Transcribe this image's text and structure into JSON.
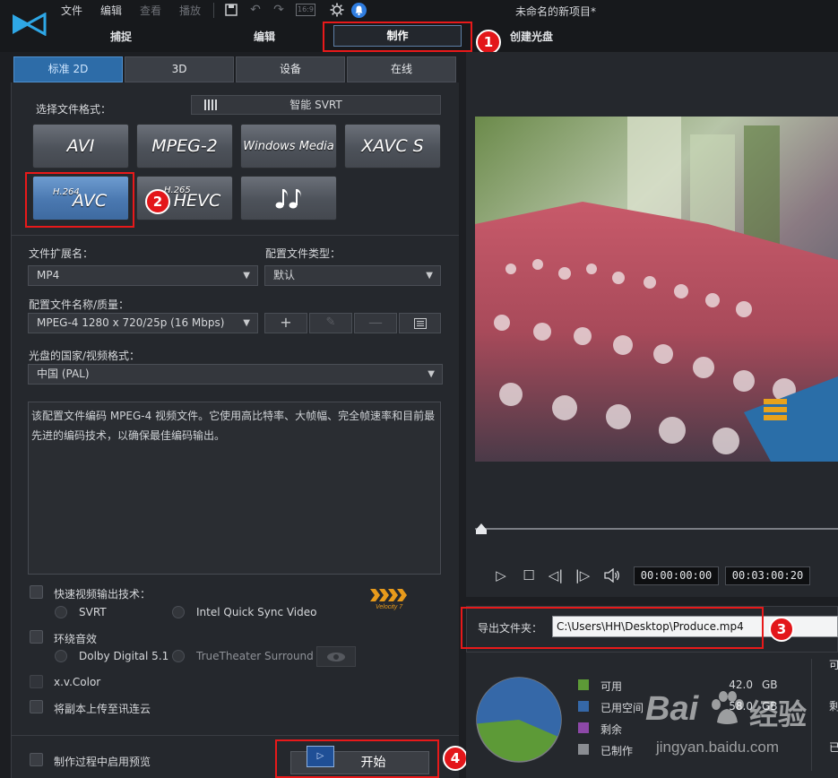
{
  "app": {
    "title": "未命名的新项目*",
    "menu": [
      "文件",
      "编辑",
      "查看",
      "播放"
    ],
    "ratio_label": "16:9"
  },
  "modes": {
    "capture": "捕捉",
    "edit": "编辑",
    "produce": "制作",
    "disc": "创建光盘"
  },
  "badges": [
    "1",
    "2",
    "3",
    "4"
  ],
  "categories": [
    "标准 2D",
    "3D",
    "设备",
    "在线"
  ],
  "format": {
    "select_label": "选择文件格式：",
    "svrt_label": "智能 SVRT",
    "buttons": [
      "AVI",
      "MPEG-2",
      "Windows Media",
      "XAVC S",
      "AVC",
      "HEVC"
    ],
    "avc_sup": "H.264",
    "hevc_sup": "H.265",
    "audio_icon": "music-notes-icon"
  },
  "settings": {
    "ext_label": "文件扩展名：",
    "ext_value": "MP4",
    "profile_type_label": "配置文件类型：",
    "profile_type_value": "默认",
    "profile_label": "配置文件名称/质量：",
    "profile_value": "MPEG-4 1280 x 720/25p (16 Mbps)",
    "country_label": "光盘的国家/视频格式：",
    "country_value": "中国 (PAL)",
    "description": "该配置文件编码 MPEG-4 视频文件。它使用高比特率、大帧幅、完全帧速率和目前最先进的编码技术，以确保最佳编码输出。"
  },
  "options": {
    "fast_render": "快速视频输出技术：",
    "svrt": "SVRT",
    "intel": "Intel Quick Sync Video",
    "surround": "环绕音效",
    "dolby": "Dolby Digital 5.1",
    "truetheater": "TrueTheater Surround",
    "xvcolor": "x.v.Color",
    "upload": "将副本上传至讯连云",
    "preview": "制作过程中启用预览",
    "velocity": "Velocity 7"
  },
  "start_label": "开始",
  "player": {
    "time_current": "00:00:00:00",
    "time_total": "00:03:00:20"
  },
  "export": {
    "label": "导出文件夹：",
    "path": "C:\\Users\\HH\\Desktop\\Produce.mp4"
  },
  "disk": {
    "items": [
      {
        "label": "可用",
        "value": "42.0",
        "unit": "GB",
        "color": "#5d9a37"
      },
      {
        "label": "已用空间",
        "value": "58.0",
        "unit": "GB",
        "color": "#3568a8"
      },
      {
        "label": "剩余",
        "value": "",
        "unit": "",
        "color": "#8d48a8"
      },
      {
        "label": "已制作",
        "value": "",
        "unit": "",
        "color": "#8a8d92"
      }
    ],
    "pie_fraction_used": 0.58,
    "right_cut": [
      "可",
      "剩",
      "已"
    ]
  },
  "watermark": {
    "brand": "Bai",
    "brand_cn": "经验",
    "url": "jingyan.baidu.com"
  }
}
